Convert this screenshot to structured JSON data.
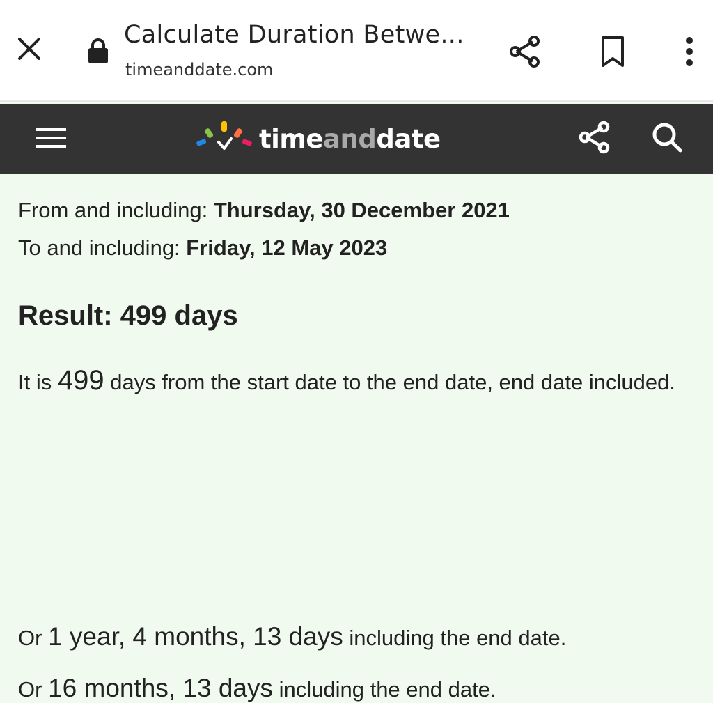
{
  "browser": {
    "page_title": "Calculate Duration Betwe...",
    "url": "timeanddate.com"
  },
  "site": {
    "brand_part1": "time",
    "brand_part2": "and",
    "brand_part3": "date"
  },
  "result": {
    "from_label": "From and including:",
    "from_value": "Thursday, 30 December 2021",
    "to_label": "To and including:",
    "to_value": "Friday, 12 May 2023",
    "heading": "Result: 499 days",
    "para_prefix": "It is ",
    "para_days": "499",
    "para_suffix": " days from the start date to the end date, end date included.",
    "alt1_prefix": "Or ",
    "alt1_value": "1 year, 4 months, 13 days",
    "alt1_suffix": " including the end date.",
    "alt2_prefix": "Or ",
    "alt2_value": "16 months, 13 days",
    "alt2_suffix": " including the end date."
  },
  "colors": {
    "page_background": "#f1faee",
    "header_background": "#333333",
    "logo_dots": [
      "#1e88e5",
      "#8bc34a",
      "#ffc107",
      "#ff7043",
      "#e91e63"
    ]
  },
  "icons": [
    "close-icon",
    "lock-icon",
    "share-icon",
    "bookmark-icon",
    "more-vert-icon",
    "menu-icon",
    "share-icon",
    "search-icon"
  ]
}
